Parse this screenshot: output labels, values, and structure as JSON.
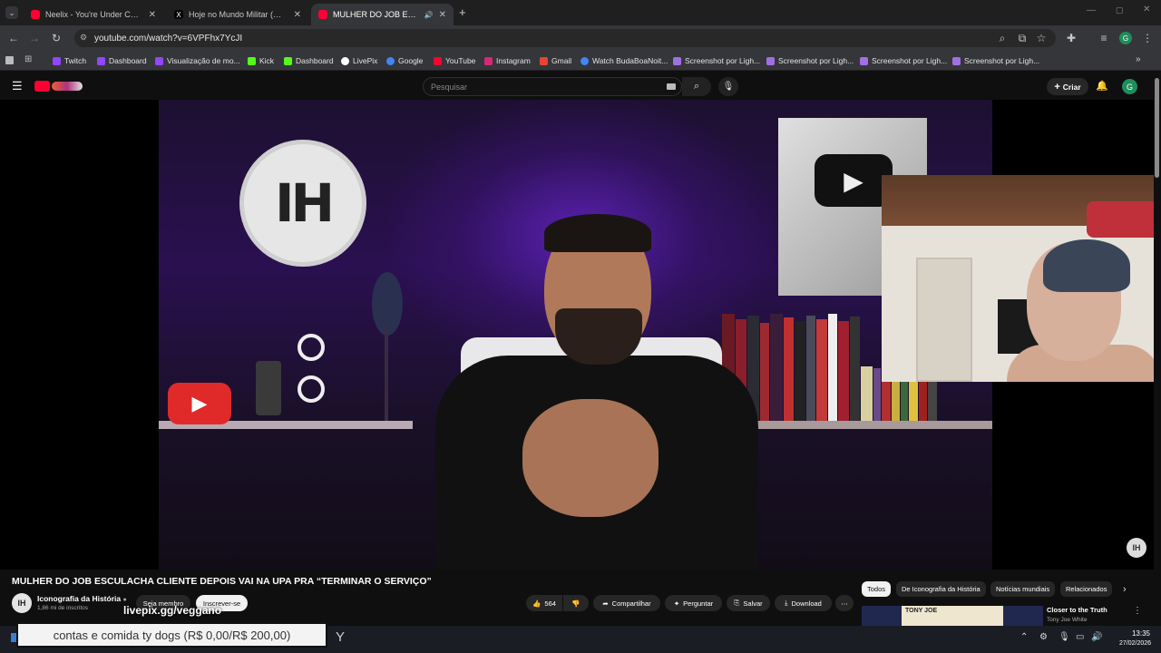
{
  "browser": {
    "tabs": [
      {
        "title": "Neelix - You're Under Control (",
        "color": "#ff0033"
      },
      {
        "title": "Hoje no Mundo Militar (@hoje",
        "color": "#000000"
      },
      {
        "title": "MULHER DO JOB ESCULAC",
        "color": "#ff0033"
      }
    ],
    "new_tab": "+",
    "url": "youtube.com/watch?v=6VPFhx7YcJI",
    "bookmarks": [
      {
        "label": "Twitch",
        "color": "#9146ff"
      },
      {
        "label": "Dashboard",
        "color": "#9146ff"
      },
      {
        "label": "Visualização de mo...",
        "color": "#9146ff"
      },
      {
        "label": "Kick",
        "color": "#53fc18"
      },
      {
        "label": "Dashboard",
        "color": "#53fc18"
      },
      {
        "label": "LivePix",
        "color": "#ffffff"
      },
      {
        "label": "Google",
        "color": "#4285f4"
      },
      {
        "label": "YouTube",
        "color": "#ff0033"
      },
      {
        "label": "Instagram",
        "color": "#d62976"
      },
      {
        "label": "Gmail",
        "color": "#ea4335"
      },
      {
        "label": "Watch BudaBoaNoit...",
        "color": "#4285f4"
      },
      {
        "label": "Screenshot por Ligh...",
        "color": "#a070e0"
      },
      {
        "label": "Screenshot por Ligh...",
        "color": "#a070e0"
      },
      {
        "label": "Screenshot por Ligh...",
        "color": "#a070e0"
      },
      {
        "label": "Screenshot por Ligh...",
        "color": "#a070e0"
      }
    ]
  },
  "youtube": {
    "search_placeholder": "Pesquisar",
    "create_label": "Criar",
    "avatar_letter": "G",
    "video_title": "MULHER DO JOB ESCULACHA CLIENTE DEPOIS VAI NA UPA PRA “TERMINAR O SERVIÇO”",
    "channel_name": "Iconografia da História",
    "channel_subs": "1,86 mi de inscritos",
    "channel_logo": "IH",
    "member_label": "Seja membro",
    "subscribe_label": "Inscrever-se",
    "likes": "564",
    "share_label": "Compartilhar",
    "ask_label": "Perguntar",
    "save_label": "Salvar",
    "download_label": "Download",
    "chips": [
      "Todos",
      "De Iconografia da História",
      "Notícias mundiais",
      "Relacionados"
    ],
    "related": {
      "thumb_text": "TONY JOE",
      "title": "Closer to the Truth",
      "channel": "Tony Joe White"
    }
  },
  "overlay": {
    "livepix": "livepix.gg/veggano",
    "donation": "contas e comida ty dogs (R$ 0,00/R$ 200,00)"
  },
  "taskbar": {
    "time": "13:35",
    "date": "27/02/2026"
  }
}
